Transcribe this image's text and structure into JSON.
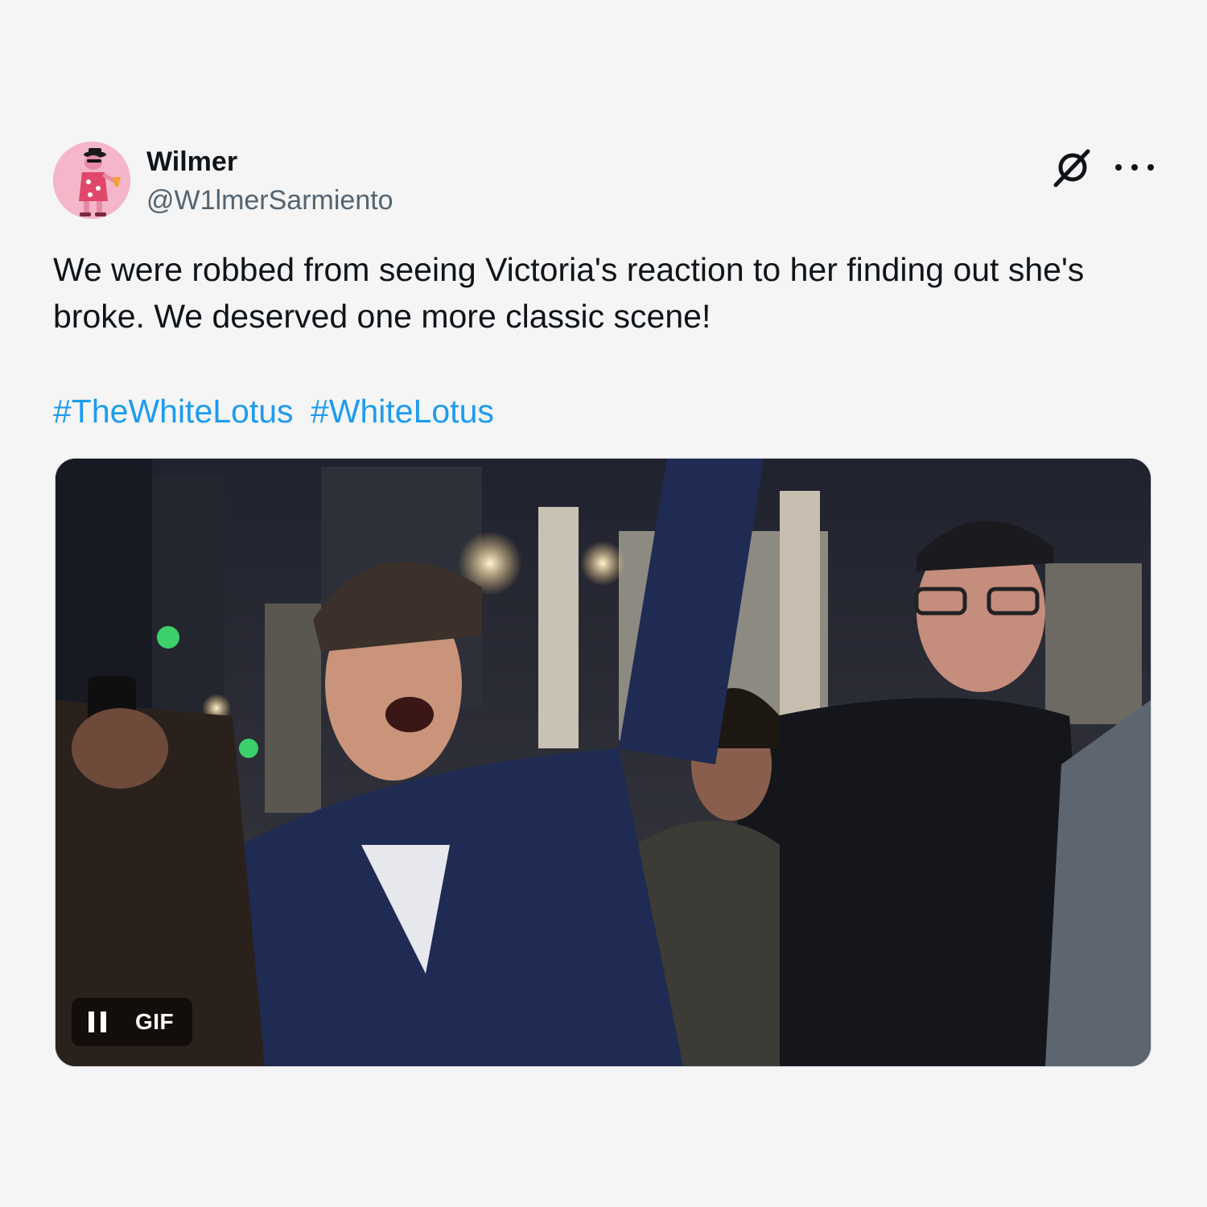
{
  "tweet": {
    "author": {
      "display_name": "Wilmer",
      "handle": "@W1lmerSarmiento",
      "avatar_icon": "pink-panther-avatar"
    },
    "text": "We were robbed from seeing Victoria's reaction to her finding out she's broke. We deserved one more classic scene!",
    "hashtags": [
      "#TheWhiteLotus",
      "#WhiteLotus"
    ],
    "media": {
      "type": "GIF",
      "label": "GIF",
      "state": "playing"
    }
  },
  "header_icons": {
    "platform": "x-logo-icon",
    "menu": "more-options-icon"
  },
  "colors": {
    "background": "#f5f5f5",
    "text": "#0f1419",
    "secondary_text": "#536471",
    "link": "#1d9bf0"
  }
}
